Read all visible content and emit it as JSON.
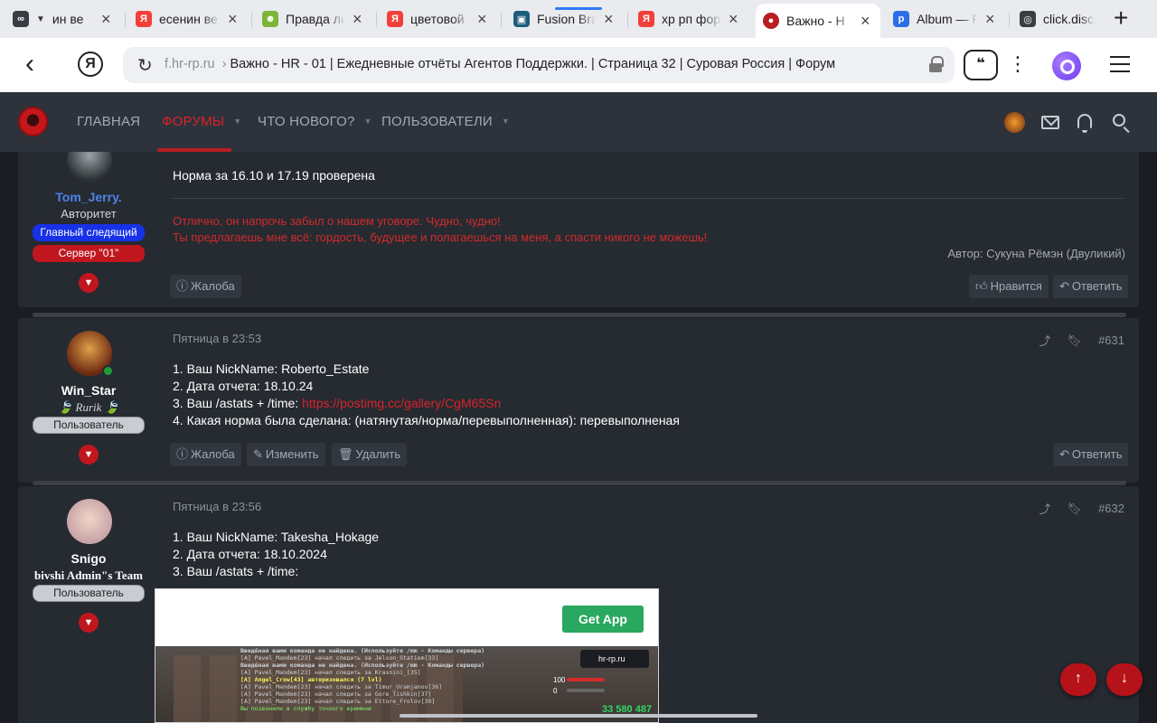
{
  "browser": {
    "tabs": [
      {
        "title": "ин ве",
        "favicon": "∞"
      },
      {
        "title": "есенин ве",
        "favicon": "Я"
      },
      {
        "title": "Правда ли",
        "favicon": "☻"
      },
      {
        "title": "цветовой",
        "favicon": "Я"
      },
      {
        "title": "Fusion Bra",
        "favicon": "▣"
      },
      {
        "title": "хр рп фор",
        "favicon": "Я"
      },
      {
        "title": "Важно - Н",
        "favicon": "●"
      },
      {
        "title": "Album — F",
        "favicon": "p"
      },
      {
        "title": "click.disco",
        "favicon": "◎"
      }
    ],
    "new_tab": "+",
    "url_domain": "f.hr-rp.ru",
    "url_title": "Важно - HR - 01 | Ежедневные отчёты Агентов Поддержки. | Страница 32 | Суровая Россия | Форум",
    "yandex_logo": "Я"
  },
  "forum_nav": {
    "items": [
      {
        "label": "ГЛАВНАЯ",
        "caret": false
      },
      {
        "label": "ФОРУМЫ",
        "caret": true
      },
      {
        "label": "ЧТО НОВОГО?",
        "caret": true
      },
      {
        "label": "ПОЛЬЗОВАТЕЛИ",
        "caret": true
      }
    ]
  },
  "posts": [
    {
      "user": "Tom_Jerry.",
      "title": "Авторитет",
      "badges": [
        "Главный следящий",
        "Сервер \"01\""
      ],
      "body": [
        "Норма за 16.10 и 17.19 проверена"
      ],
      "signature": [
        "Отлично, он напрочь забыл о нашем уговоре. Чудно, чудно!",
        "Ты предлагаешь мне всё: гордость, будущее и полагаешься на меня, а спасти никого не можешь!"
      ],
      "signature_author": "Автор: Сукуна Рёмэн (Двуликий)",
      "buttons_left": [
        "Жалоба"
      ],
      "buttons_right": [
        "Нравится",
        "Ответить"
      ]
    },
    {
      "user": "Win_Star",
      "title": "🍃 Rurik 🍃",
      "badges": [
        "Пользователь"
      ],
      "time": "Пятница в 23:53",
      "number": "#631",
      "body": [
        "1. Ваш NickName: Roberto_Estate",
        "2. Дата отчета: 18.10.24",
        "3. Ваш /astats + /time: ",
        "4. Какая норма была сделана: (натянутая/норма/перевыполненная): перевыполненая"
      ],
      "link": "https://postimg.cc/gallery/CgM65Sn",
      "buttons_left": [
        "Жалоба",
        "Изменить",
        "Удалить"
      ],
      "buttons_right": [
        "Ответить"
      ]
    },
    {
      "user": "Snigo",
      "title": "bivshi Admin\"s Team",
      "badges": [
        "Пользователь"
      ],
      "time": "Пятница в 23:56",
      "number": "#632",
      "body": [
        "1. Ваш NickName: Takesha_Hokage",
        "2. Дата отчета: 18.10.2024",
        "3. Ваш /astats + /time:"
      ],
      "attachment": {
        "get_app": "Get App",
        "game_lines": [
          "Введёная вами команда не найдена. (Используйте  /mm - Команды сервера)",
          "[A] Pavel_Mandem[23] начал следить за Jelson_Statiem[33]",
          "Введёная вами команда не найдена. (Используйте  /mm - Команды сервера)",
          "[A] Pavel_Mandem[23] начал следить за Krasnini_[35]",
          "[A] Angel_Crow[43] авторизовался (7 lvl)",
          "[A] Pavel_Mandem[23] начал следить за Timur_Uramjanov[36]",
          "[A] Pavel_Mandem[23] начал следить за Gore_Tishkin[37]",
          "[A] Pavel_Mandem[23] начал следить за Ettore_Frolov[39]",
          "Вы позвонили в службу точного времени"
        ],
        "hud_site": "hr-rp.ru",
        "hud_health": "100",
        "hud_armor": "0",
        "hud_money": "33 580 487"
      }
    }
  ],
  "fab": {
    "up": "↑",
    "down": "↓"
  }
}
